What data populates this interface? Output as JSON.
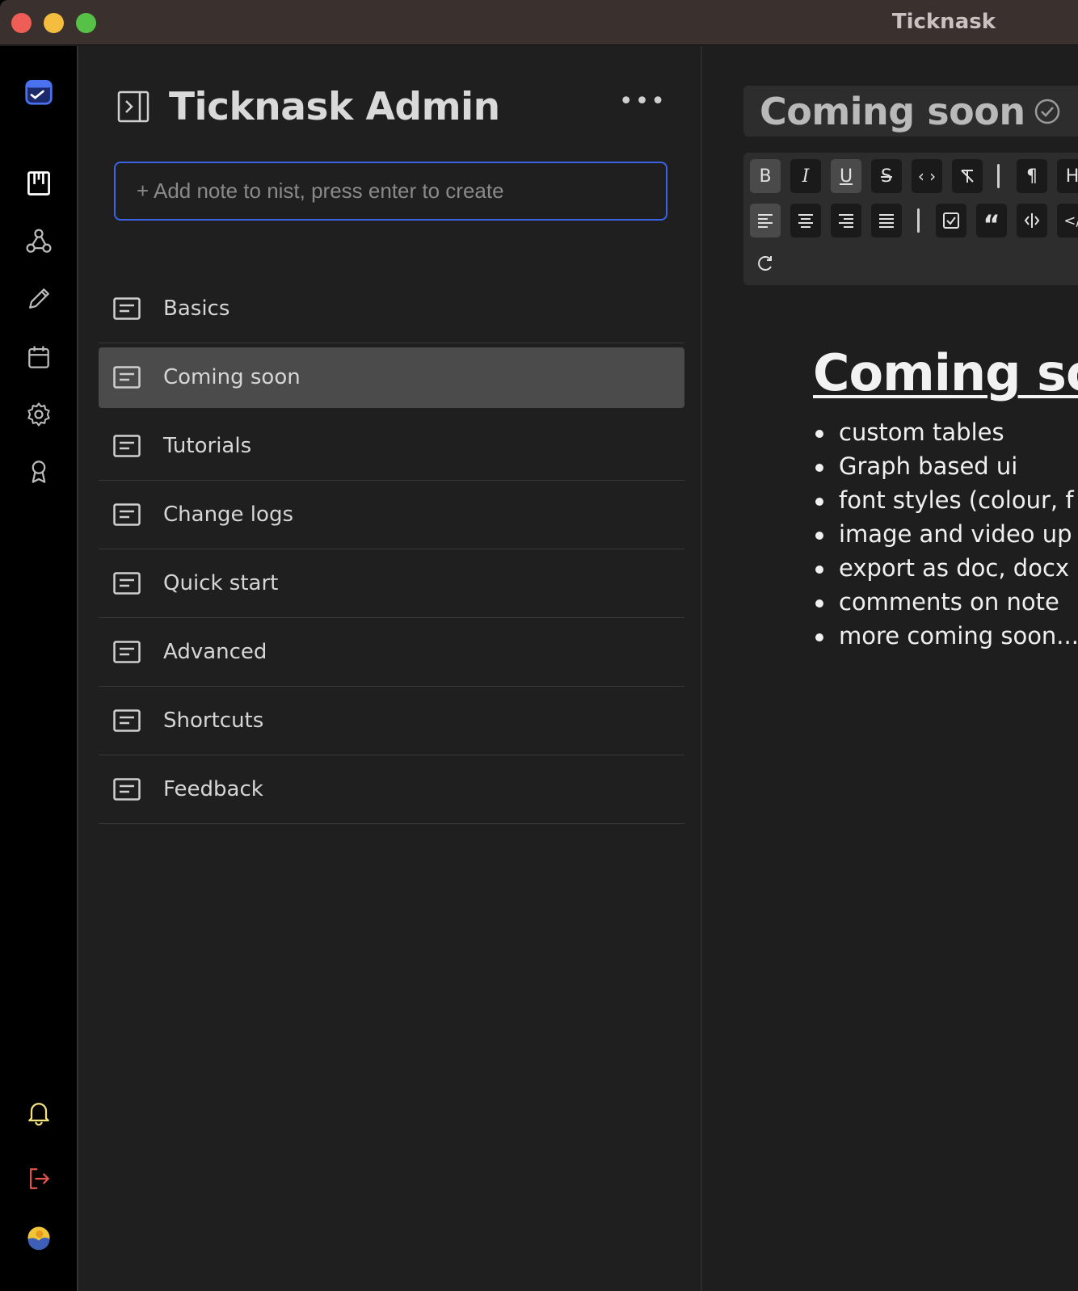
{
  "window": {
    "app_title": "Ticknask"
  },
  "rail": {
    "items": [
      {
        "name": "app-logo-icon"
      },
      {
        "name": "board-icon"
      },
      {
        "name": "webhook-icon"
      },
      {
        "name": "pencil-icon"
      },
      {
        "name": "calendar-icon"
      },
      {
        "name": "gear-icon"
      },
      {
        "name": "award-icon"
      },
      {
        "name": "bell-icon"
      },
      {
        "name": "logout-icon"
      },
      {
        "name": "avatar"
      }
    ],
    "accent": "#3b63e6",
    "bell_color": "#f3e37a",
    "logout_color": "#e5534b"
  },
  "panel": {
    "title": "Ticknask Admin",
    "more_label": "•••",
    "add_input": {
      "placeholder": "+ Add note to nist, press enter to create",
      "value": ""
    },
    "notes": [
      {
        "label": "Basics",
        "active": false
      },
      {
        "label": "Coming soon",
        "active": true
      },
      {
        "label": "Tutorials",
        "active": false
      },
      {
        "label": "Change logs",
        "active": false
      },
      {
        "label": "Quick start",
        "active": false
      },
      {
        "label": "Advanced",
        "active": false
      },
      {
        "label": "Shortcuts",
        "active": false
      },
      {
        "label": "Feedback",
        "active": false
      }
    ]
  },
  "editor": {
    "doc_title": "Coming soon",
    "toolbar": {
      "bold": "B",
      "italic": "I",
      "underline": "U",
      "strike": "S",
      "code": "‹ ›",
      "paragraph": "¶",
      "heading": "H",
      "quote": "“",
      "code_block": "</"
    },
    "content": {
      "heading": "Coming soon",
      "bullets": [
        "custom tables",
        "Graph based ui",
        "font styles (colour, f",
        "image and video up",
        "export as doc, docx",
        "comments on note",
        "more coming soon..."
      ]
    }
  }
}
